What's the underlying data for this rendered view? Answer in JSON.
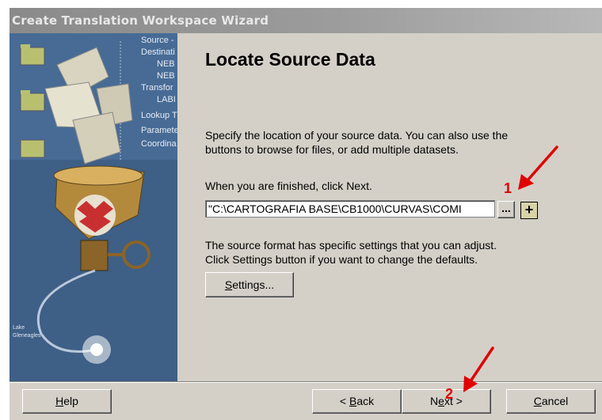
{
  "window": {
    "title": "Create Translation Workspace Wizard"
  },
  "sidebar_labels": [
    "Source -",
    "Destinati",
    "NEB",
    "NEB",
    "Transfor",
    "LABI",
    "Lookup T",
    "Paramete",
    "Coordina"
  ],
  "heading": "Locate Source Data",
  "description_lines": [
    "Specify the location of your source data. You can also use the",
    "buttons to browse for files, or add multiple datasets."
  ],
  "finish_hint": "When you are finished, click Next.",
  "source_path": "\"C:\\CARTOGRAFIA BASE\\CB1000\\CURVAS\\COMI",
  "browse_label": "...",
  "add_label": "+",
  "settings_lines": [
    "The source format has specific settings that you can adjust.",
    "Click Settings button if you want to change the defaults."
  ],
  "buttons": {
    "settings": {
      "key": "S",
      "rest": "ettings..."
    },
    "help": {
      "key": "H",
      "rest": "elp"
    },
    "back": {
      "pre": "< ",
      "key": "B",
      "rest": "ack"
    },
    "next": {
      "pre": "N",
      "key": "e",
      "rest": "xt >"
    },
    "cancel": {
      "key": "C",
      "rest": "ancel"
    }
  },
  "annotations": {
    "step1": "1",
    "step2": "2",
    "arrow_color": "#e00000"
  },
  "map_labels": [
    "Lake",
    "Gleneagles"
  ]
}
